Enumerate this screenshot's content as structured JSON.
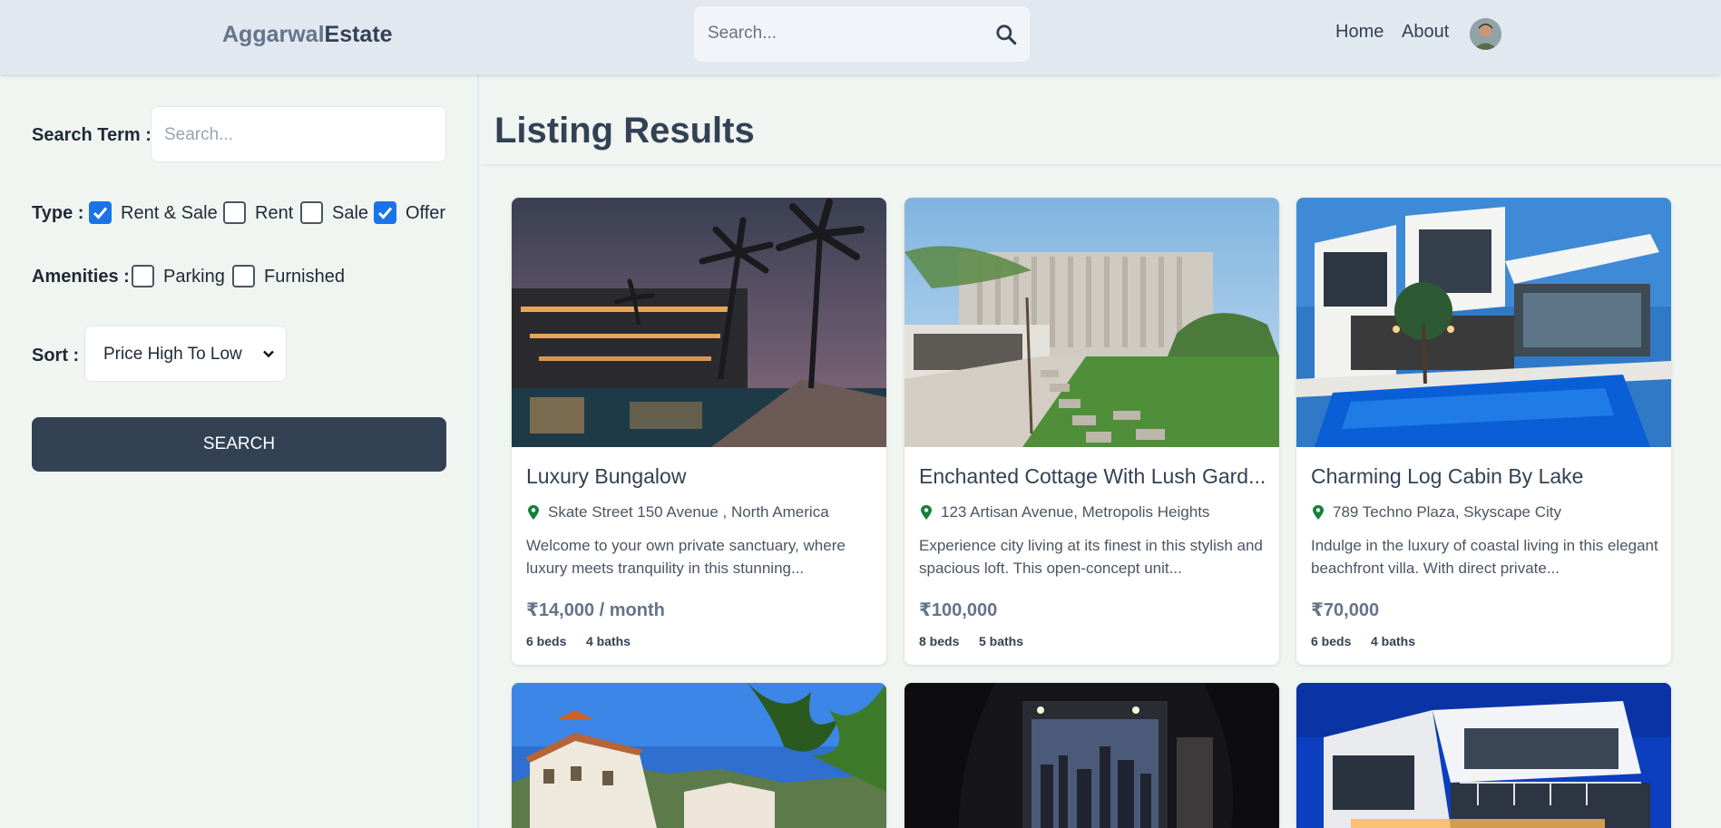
{
  "header": {
    "logo_part1": "Aggarwal",
    "logo_part2": "Estate",
    "search_placeholder": "Search...",
    "nav": [
      "Home",
      "About"
    ]
  },
  "sidebar": {
    "search_term_label": "Search Term :",
    "search_placeholder": "Search...",
    "type_label": "Type :",
    "type_options": [
      {
        "label": "Rent & Sale",
        "checked": true
      },
      {
        "label": "Rent",
        "checked": false
      },
      {
        "label": "Sale",
        "checked": false
      },
      {
        "label": "Offer",
        "checked": true
      }
    ],
    "amenities_label": "Amenities :",
    "amenities_options": [
      {
        "label": "Parking",
        "checked": false
      },
      {
        "label": "Furnished",
        "checked": false
      }
    ],
    "sort_label": "Sort :",
    "sort_value": "Price High To Low",
    "search_button": "SEARCH"
  },
  "main": {
    "title": "Listing Results",
    "listings": [
      {
        "title": "Luxury Bungalow",
        "address": "Skate Street 150 Avenue , North America",
        "description": "Welcome to your own private sanctuary, where luxury meets tranquility in this stunning...",
        "price": "₹14,000 / month",
        "beds": "6 beds",
        "baths": "4 baths"
      },
      {
        "title": "Enchanted Cottage With Lush Gard...",
        "address": "123 Artisan Avenue, Metropolis Heights",
        "description": "Experience city living at its finest in this stylish and spacious loft. This open-concept unit...",
        "price": "₹100,000",
        "beds": "8 beds",
        "baths": "5 baths"
      },
      {
        "title": "Charming Log Cabin By Lake",
        "address": "789 Techno Plaza, Skyscape City",
        "description": "Indulge in the luxury of coastal living in this elegant beachfront villa. With direct private...",
        "price": "₹70,000",
        "beds": "6 beds",
        "baths": "4 baths"
      }
    ]
  },
  "colors": {
    "accent": "#334155",
    "checkbox": "#1a73e8",
    "pin": "#15803d"
  }
}
